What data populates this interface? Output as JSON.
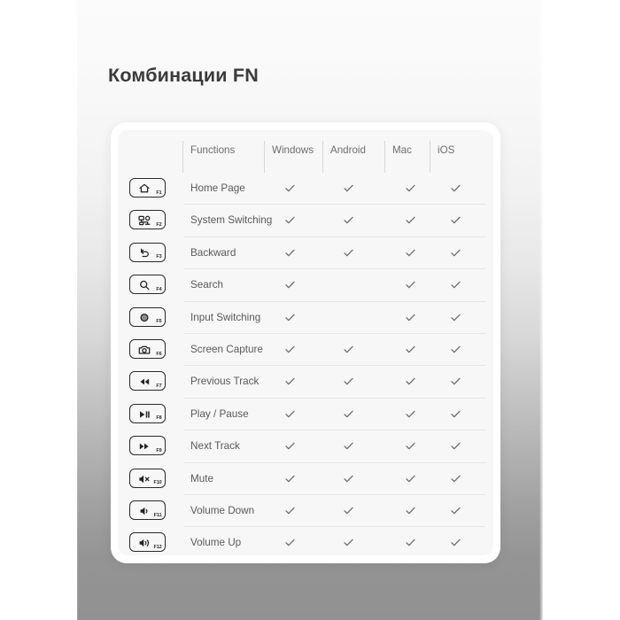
{
  "page": {
    "title": "Комбинации FN",
    "background_top_color": "#fbfbfb",
    "background_bottom_color": "#919191",
    "card_color": "#ffffff",
    "card_inner_color": "#f7f7f7",
    "text_color": "#5a5a5a",
    "header_text_color": "#6e6e6e",
    "separator_color": "#e6e6e6",
    "key_border_color": "#2a2a2a"
  },
  "table": {
    "columns": [
      {
        "key": "function",
        "label": "Functions"
      },
      {
        "key": "windows",
        "label": "Windows"
      },
      {
        "key": "android",
        "label": "Android"
      },
      {
        "key": "mac",
        "label": "Mac"
      },
      {
        "key": "ios",
        "label": "iOS"
      }
    ],
    "rows": [
      {
        "fn": "F1",
        "icon": "home-icon",
        "label": "Home Page",
        "windows": true,
        "android": true,
        "mac": true,
        "ios": true
      },
      {
        "fn": "F2",
        "icon": "task-switch-icon",
        "label": "System Switching",
        "windows": true,
        "android": true,
        "mac": true,
        "ios": true
      },
      {
        "fn": "F3",
        "icon": "back-arrow-icon",
        "label": "Backward",
        "windows": true,
        "android": true,
        "mac": true,
        "ios": true
      },
      {
        "fn": "F4",
        "icon": "search-icon",
        "label": "Search",
        "windows": true,
        "android": false,
        "mac": true,
        "ios": true
      },
      {
        "fn": "F5",
        "icon": "input-source-icon",
        "label": "Input Switching",
        "windows": true,
        "android": false,
        "mac": true,
        "ios": true
      },
      {
        "fn": "F6",
        "icon": "camera-icon",
        "label": "Screen Capture",
        "windows": true,
        "android": true,
        "mac": true,
        "ios": true
      },
      {
        "fn": "F7",
        "icon": "previous-track-icon",
        "label": "Previous Track",
        "windows": true,
        "android": true,
        "mac": true,
        "ios": true
      },
      {
        "fn": "F8",
        "icon": "play-pause-icon",
        "label": "Play / Pause",
        "windows": true,
        "android": true,
        "mac": true,
        "ios": true
      },
      {
        "fn": "F9",
        "icon": "next-track-icon",
        "label": "Next Track",
        "windows": true,
        "android": true,
        "mac": true,
        "ios": true
      },
      {
        "fn": "F10",
        "icon": "mute-icon",
        "label": "Mute",
        "windows": true,
        "android": true,
        "mac": true,
        "ios": true
      },
      {
        "fn": "F11",
        "icon": "volume-down-icon",
        "label": "Volume Down",
        "windows": true,
        "android": true,
        "mac": true,
        "ios": true
      },
      {
        "fn": "F12",
        "icon": "volume-up-icon",
        "label": "Volume Up",
        "windows": true,
        "android": true,
        "mac": true,
        "ios": true
      }
    ]
  }
}
